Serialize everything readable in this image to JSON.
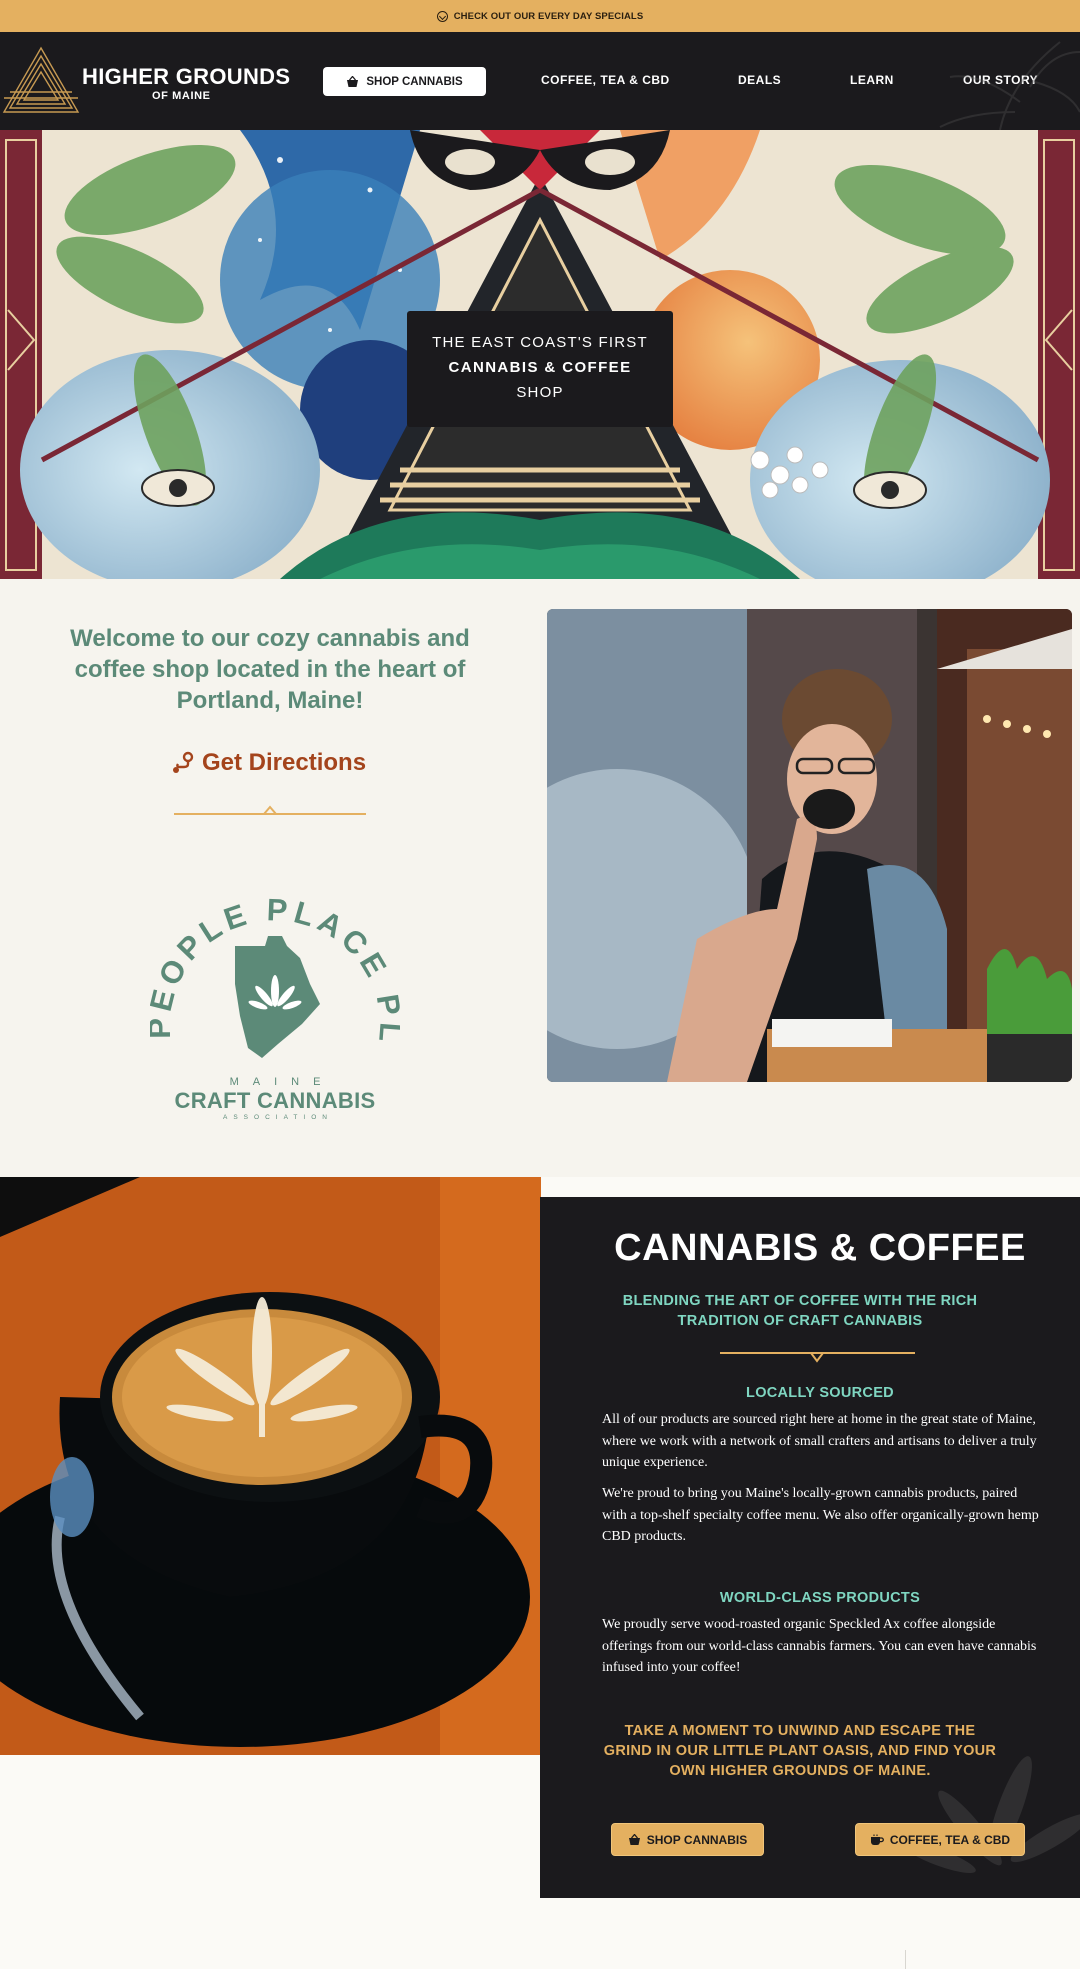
{
  "topbar": {
    "text": "CHECK OUT OUR EVERY DAY SPECIALS"
  },
  "header": {
    "brand_title": "HIGHER GROUNDS",
    "brand_sub": "OF MAINE",
    "shop_button": "SHOP CANNABIS",
    "nav": [
      "COFFEE, TEA & CBD",
      "DEALS",
      "LEARN",
      "OUR STORY"
    ]
  },
  "hero": {
    "line1": "THE EAST COAST'S FIRST",
    "line2": "CANNABIS & COFFEE",
    "line3": "SHOP"
  },
  "welcome": {
    "text": "Welcome to our cozy cannabis and coffee shop located in the heart of Portland, Maine!",
    "directions": "Get Directions",
    "badge": {
      "arc_text": "PEOPLE PLACE PLANT",
      "maine": "MAINE",
      "craft": "CRAFT CANNABIS",
      "assoc": "ASSOCIATION"
    }
  },
  "cannabis_coffee": {
    "title": "CANNABIS & COFFEE",
    "subtitle": "BLENDING THE ART OF COFFEE WITH THE RICH TRADITION OF CRAFT CANNABIS",
    "locally_heading": "LOCALLY SOURCED",
    "locally_p1": "All of our products are sourced right here at home in the great state of Maine, where we work with a network of small crafters and artisans to deliver a truly unique experience.",
    "locally_p2": "We're proud to bring you Maine's locally-grown cannabis products, paired with a top-shelf specialty coffee menu. We also offer organically-grown hemp CBD products.",
    "world_heading": "WORLD-CLASS PRODUCTS",
    "world_p1": "We proudly serve wood-roasted organic Speckled Ax coffee alongside offerings from our world-class cannabis farmers. You can even have cannabis infused into your coffee!",
    "cta": "TAKE A MOMENT TO UNWIND AND ESCAPE THE GRIND IN OUR LITTLE PLANT OASIS, AND FIND YOUR OWN HIGHER GROUNDS OF MAINE.",
    "btn_shop": "SHOP CANNABIS",
    "btn_coffee": "COFFEE, TEA & CBD"
  },
  "colors": {
    "gold": "#e4b060",
    "dark": "#1b1a1d",
    "teal": "#7fd6c1",
    "sage": "#5c8a78",
    "rust": "#a4441c"
  }
}
